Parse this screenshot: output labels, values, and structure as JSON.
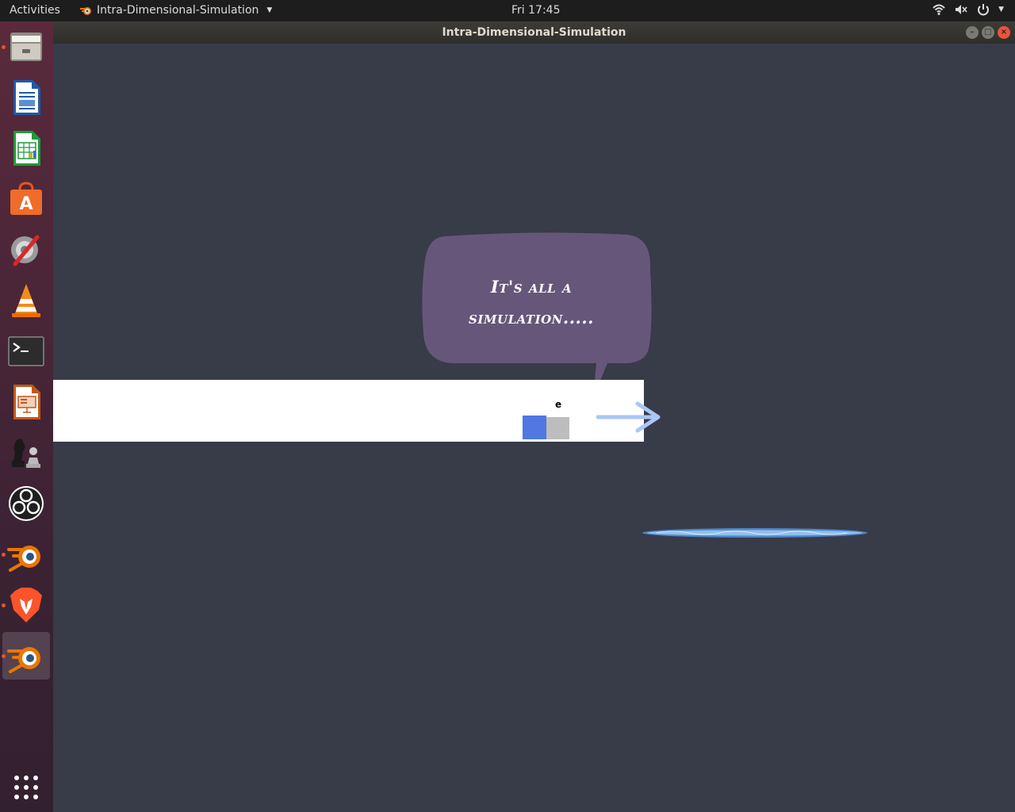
{
  "topbar": {
    "activities": "Activities",
    "app_name": "Intra-Dimensional-Simulation",
    "clock": "Fri 17:45"
  },
  "window": {
    "title": "Intra-Dimensional-Simulation"
  },
  "dock": {
    "items": [
      {
        "icon": "files-icon",
        "running": true
      },
      {
        "icon": "libreoffice-writer-icon",
        "running": false
      },
      {
        "icon": "libreoffice-calc-icon",
        "running": false
      },
      {
        "icon": "software-center-icon",
        "running": false
      },
      {
        "icon": "system-tools-icon",
        "running": false
      },
      {
        "icon": "vlc-icon",
        "running": false
      },
      {
        "icon": "terminal-icon",
        "running": false
      },
      {
        "icon": "libreoffice-impress-icon",
        "running": false
      },
      {
        "icon": "chess-icon",
        "running": false
      },
      {
        "icon": "obs-studio-icon",
        "running": false
      },
      {
        "icon": "blender-icon",
        "running": true
      },
      {
        "icon": "brave-browser-icon",
        "running": true
      },
      {
        "icon": "blender-icon",
        "running": true,
        "active": true
      }
    ],
    "app_grid_icon": "show-applications-icon"
  },
  "game": {
    "speech_line1": "It's all a",
    "speech_line2": "simulation.....",
    "key_hint": "e",
    "colors": {
      "background": "#383b48",
      "platform": "#ffffff",
      "player_block": "#5077e2",
      "gray_block": "#bdbdbd",
      "bubble": "#66577a",
      "arrow": "#a9c6f5",
      "portal": "#6fa8e8"
    }
  }
}
